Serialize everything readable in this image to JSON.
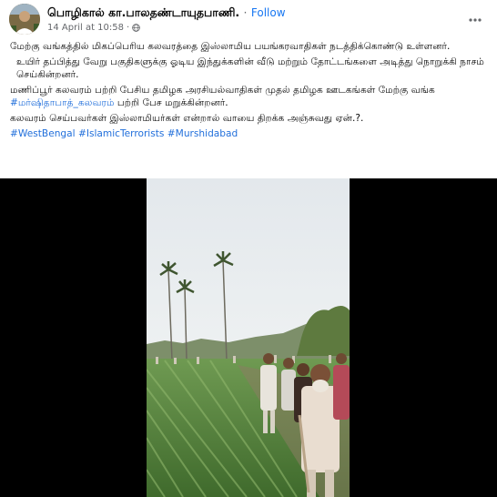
{
  "post": {
    "author": "பொழிகால் கா.பாலதண்டாயுதபாணி.",
    "separator": "·",
    "follow_label": "Follow",
    "timestamp": "14 April at 10:58",
    "meta_separator": "·",
    "icons": {
      "avatar": "avatar",
      "audience": "globe-icon",
      "more": "more-options-icon"
    },
    "body": {
      "p1": "மேற்கு வங்கத்தில் மிகப்பெரிய கலவரத்தை இஸ்லாமிய பயங்கரவாதிகள் நடத்திக்கொண்டு உள்ளனர்.",
      "p2": "உயிர் தப்பித்து வேறு பகுதிகளுக்கு ஓடிய இந்துக்களின் வீடு மற்றும் தோட்டங்களை அடித்து நொறுக்கி நாசம் செய்கின்றனர்.",
      "p3_before": "மணிப்பூர் கலவரம் பற்றி பேசிய தமிழக அரசியல்வாதிகள் முதல் தமிழக ஊடகங்கள் மேற்கு வங்க ",
      "p3_tag": "#மர்ஷிதாபாத்_கலவரம்",
      "p3_after": " பற்றி பேச மறுக்கின்றனர்.",
      "p4": "கலவரம் செய்பவர்கள் இஸ்லாமியர்கள் என்றால் வாயை திறக்க அஞ்சுவது ஏன்.?.",
      "hashtags": "#WestBengal #IslamicTerrorists #Murshidabad"
    },
    "colors": {
      "link": "#216fdb",
      "follow": "#1877f2",
      "meta": "#65676b",
      "video_bg": "#000000"
    }
  }
}
